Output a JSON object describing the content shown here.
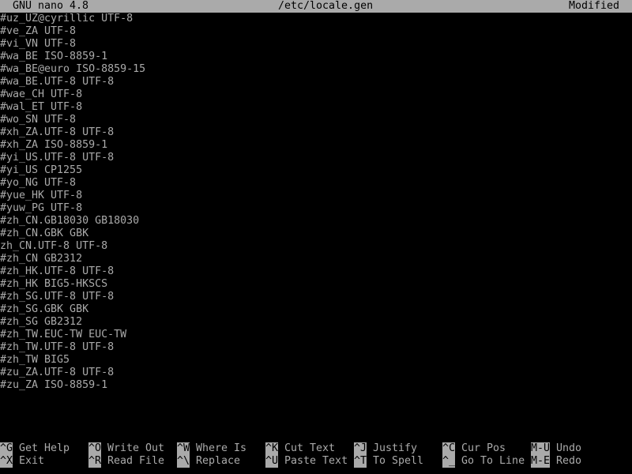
{
  "titlebar": {
    "app": "GNU nano 4.8",
    "filename": "/etc/locale.gen",
    "status": "Modified"
  },
  "lines": [
    "#uz_UZ@cyrillic UTF-8",
    "#ve_ZA UTF-8",
    "#vi_VN UTF-8",
    "#wa_BE ISO-8859-1",
    "#wa_BE@euro ISO-8859-15",
    "#wa_BE.UTF-8 UTF-8",
    "#wae_CH UTF-8",
    "#wal_ET UTF-8",
    "#wo_SN UTF-8",
    "#xh_ZA.UTF-8 UTF-8",
    "#xh_ZA ISO-8859-1",
    "#yi_US.UTF-8 UTF-8",
    "#yi_US CP1255",
    "#yo_NG UTF-8",
    "#yue_HK UTF-8",
    "#yuw_PG UTF-8",
    "#zh_CN.GB18030 GB18030",
    "#zh_CN.GBK GBK",
    "zh_CN.UTF-8 UTF-8",
    "#zh_CN GB2312",
    "#zh_HK.UTF-8 UTF-8",
    "#zh_HK BIG5-HKSCS",
    "#zh_SG.UTF-8 UTF-8",
    "#zh_SG.GBK GBK",
    "#zh_SG GB2312",
    "#zh_TW.EUC-TW EUC-TW",
    "#zh_TW.UTF-8 UTF-8",
    "#zh_TW BIG5",
    "#zu_ZA.UTF-8 UTF-8",
    "#zu_ZA ISO-8859-1"
  ],
  "shortcuts": {
    "row1": [
      {
        "key": "^G",
        "label": "Get Help"
      },
      {
        "key": "^O",
        "label": "Write Out"
      },
      {
        "key": "^W",
        "label": "Where Is"
      },
      {
        "key": "^K",
        "label": "Cut Text"
      },
      {
        "key": "^J",
        "label": "Justify"
      },
      {
        "key": "^C",
        "label": "Cur Pos"
      },
      {
        "key": "M-U",
        "label": "Undo"
      }
    ],
    "row2": [
      {
        "key": "^X",
        "label": "Exit"
      },
      {
        "key": "^R",
        "label": "Read File"
      },
      {
        "key": "^\\",
        "label": "Replace"
      },
      {
        "key": "^U",
        "label": "Paste Text"
      },
      {
        "key": "^T",
        "label": "To Spell"
      },
      {
        "key": "^_",
        "label": "Go To Line"
      },
      {
        "key": "M-E",
        "label": "Redo"
      }
    ]
  }
}
